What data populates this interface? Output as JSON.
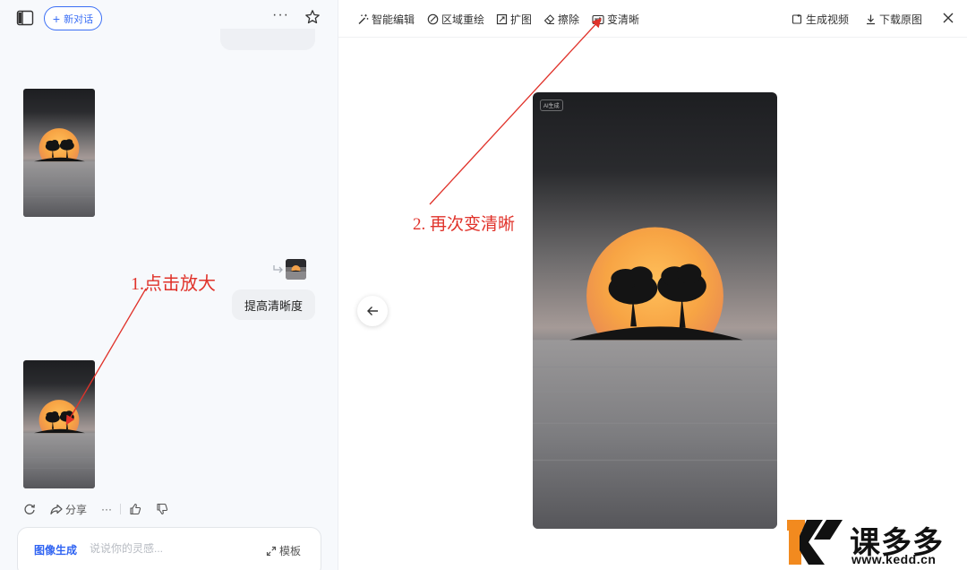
{
  "left_panel": {
    "new_chat_label": "新对话",
    "user_message": "提高清晰度",
    "actions": {
      "share_label": "分享"
    },
    "composer": {
      "mode_label": "图像生成",
      "placeholder": "说说你的灵感...",
      "template_label": "模板"
    }
  },
  "viewer": {
    "toolbar": {
      "smart_edit": "智能编辑",
      "region_redraw": "区域重绘",
      "expand": "扩图",
      "erase": "擦除",
      "sharpen": "变清晰",
      "generate_video": "生成视频",
      "download_original": "下载原图"
    },
    "image_badge": "AI生成"
  },
  "annotations": {
    "step1": "1.点击放大",
    "step2": "2. 再次变清晰"
  },
  "watermark": {
    "brand": "课多多",
    "url": "www.kedd.cn"
  },
  "colors": {
    "accent": "#2f63f2",
    "annotation_red": "#e0322a",
    "sun_orange": "#f7a444"
  }
}
